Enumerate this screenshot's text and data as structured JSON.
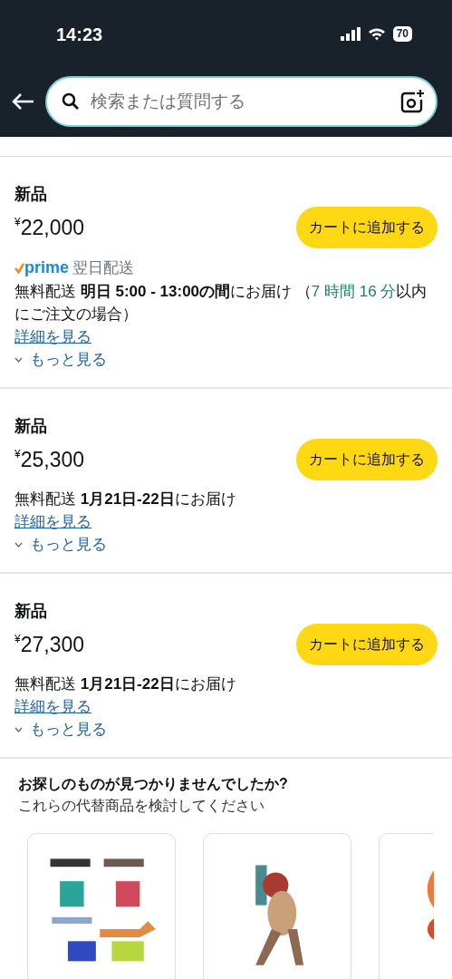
{
  "status_bar": {
    "time": "14:23",
    "battery": "70"
  },
  "search": {
    "placeholder": "検索または質問する"
  },
  "offers": [
    {
      "condition": "新品",
      "price": "$^{¥}$22,000",
      "button": "カートに追加する",
      "prime": {
        "logo": "prime",
        "label": "翌日配送"
      },
      "delivery": "無料配送 **明日 5:00 - 13:00の間**にお届け",
      "cutoff": {
        "open": " （",
        "time": "7 時間 16 分",
        "close": "以内にご注文の場合）"
      },
      "details_link": "詳細を見る",
      "more_link": "もっと見る"
    },
    {
      "condition": "新品",
      "price": "$^{¥}$25,300",
      "button": "カートに追加する",
      "delivery": "無料配送 **1月21日-22日**にお届け",
      "details_link": "詳細を見る",
      "more_link": "もっと見る"
    },
    {
      "condition": "新品",
      "price": "$^{¥}$27,300",
      "button": "カートに追加する",
      "delivery": "無料配送 **1月21日-22日**にお届け",
      "details_link": "詳細を見る",
      "more_link": "もっと見る"
    }
  ],
  "alternatives": {
    "title": "お探しのものが見つかりませんでしたか?",
    "subtitle": "これらの代替商品を検討してください"
  }
}
